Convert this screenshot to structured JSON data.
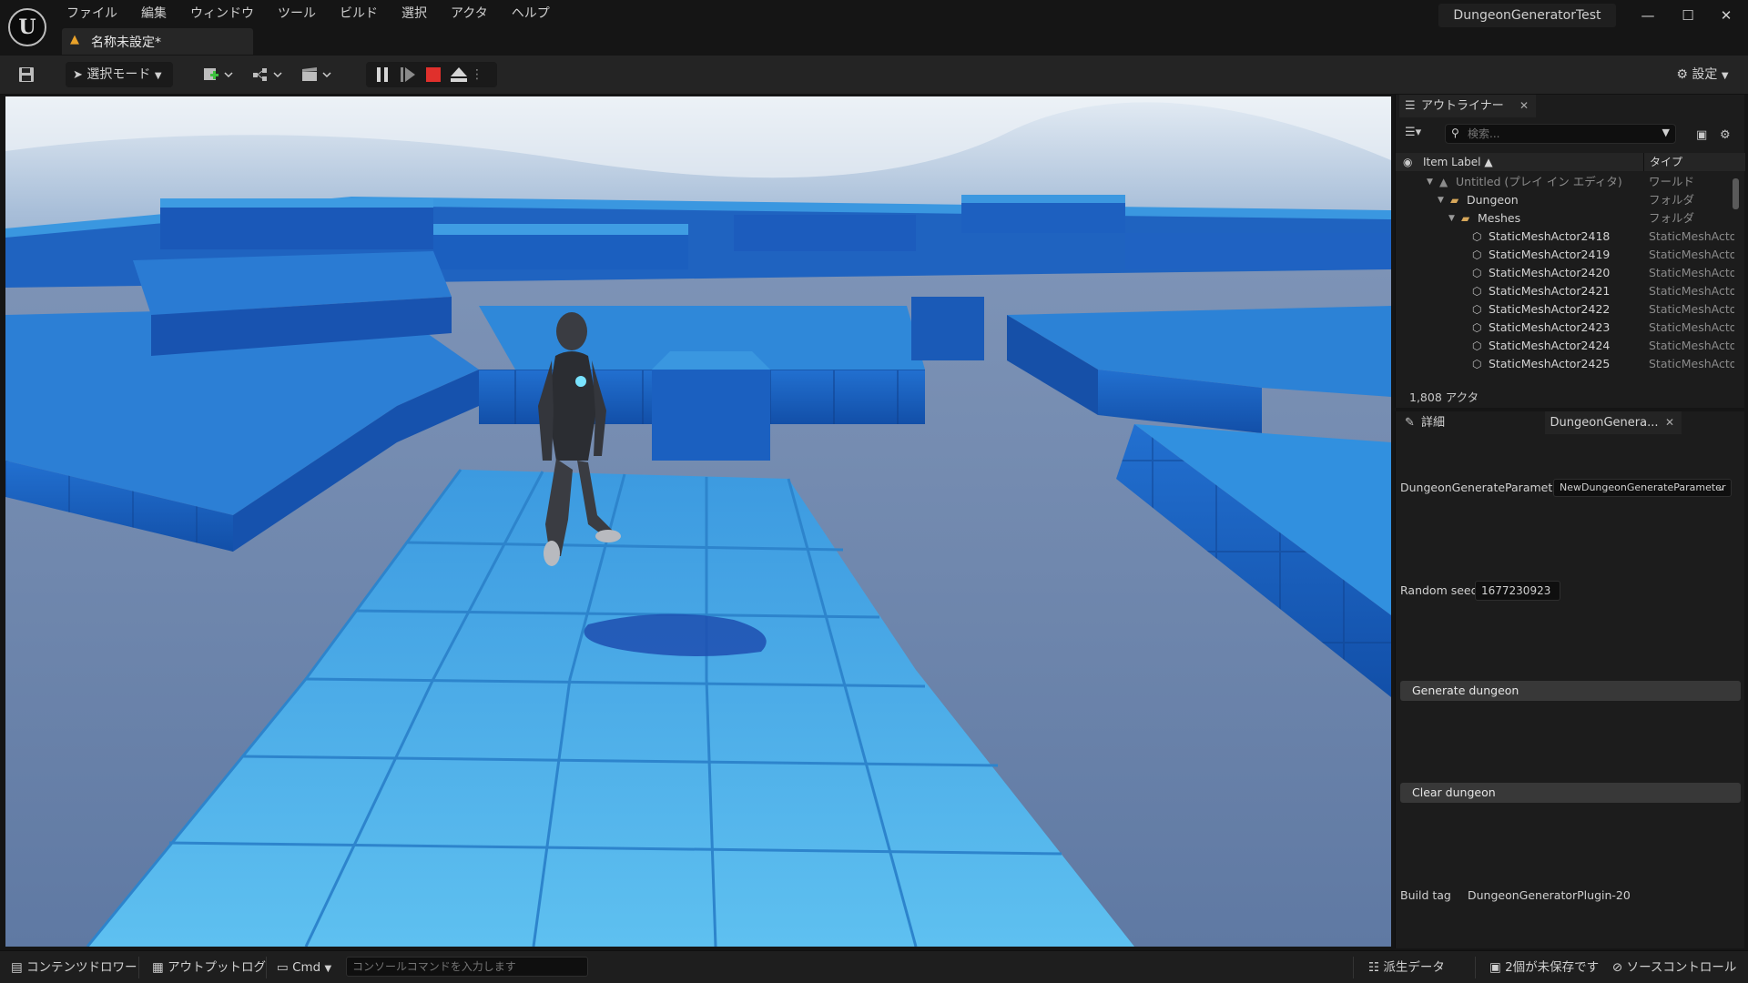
{
  "app": {
    "logo_letter": "U",
    "menu": [
      "ファイル",
      "編集",
      "ウィンドウ",
      "ツール",
      "ビルド",
      "選択",
      "アクタ",
      "ヘルプ"
    ],
    "level_tab": "名称未設定*",
    "project_name": "DungeonGeneratorTest",
    "window_controls": {
      "minimize": "—",
      "maximize": "☐",
      "close": "✕"
    }
  },
  "toolbar": {
    "mode_label": "選択モード",
    "settings_label": "設定"
  },
  "outliner": {
    "tab_label": "アウトライナー",
    "search_placeholder": "検索...",
    "col_label": "Item Label ▲",
    "col_type": "タイプ",
    "rows": [
      {
        "name": "Untitled (プレイ イン エディタ)",
        "type": "ワールド",
        "indent": 0
      },
      {
        "name": "Dungeon",
        "type": "フォルダ",
        "indent": 1
      },
      {
        "name": "Meshes",
        "type": "フォルダ",
        "indent": 2
      },
      {
        "name": "StaticMeshActor2418",
        "type": "StaticMeshActo",
        "indent": 3
      },
      {
        "name": "StaticMeshActor2419",
        "type": "StaticMeshActo",
        "indent": 3
      },
      {
        "name": "StaticMeshActor2420",
        "type": "StaticMeshActo",
        "indent": 3
      },
      {
        "name": "StaticMeshActor2421",
        "type": "StaticMeshActo",
        "indent": 3
      },
      {
        "name": "StaticMeshActor2422",
        "type": "StaticMeshActo",
        "indent": 3
      },
      {
        "name": "StaticMeshActor2423",
        "type": "StaticMeshActo",
        "indent": 3
      },
      {
        "name": "StaticMeshActor2424",
        "type": "StaticMeshActo",
        "indent": 3
      },
      {
        "name": "StaticMeshActor2425",
        "type": "StaticMeshActo",
        "indent": 3
      }
    ],
    "actor_count": "1,808 アクタ"
  },
  "details": {
    "tab_label": "詳細",
    "tab2_label": "DungeonGenera...",
    "param_label": "DungeonGenerateParameter",
    "param_value": "NewDungeonGenerateParameter",
    "seed_label": "Random seed",
    "seed_value": "1677230923",
    "generate_button": "Generate dungeon",
    "clear_button": "Clear dungeon",
    "build_tag_label": "Build tag",
    "build_tag_value": "DungeonGeneratorPlugin-20"
  },
  "statusbar": {
    "content_drawer": "コンテンツドロワー",
    "output_log": "アウトプットログ",
    "cmd_label": "Cmd",
    "cmd_placeholder": "コンソールコマンドを入力します",
    "derived_data": "派生データ",
    "unsaved": "2個が未保存です",
    "source_control": "ソースコントロール"
  },
  "colors": {
    "tile_top": "#4fb3e8",
    "tile_side": "#1a5fc0",
    "floor": "#6d84a8",
    "sky_top": "#c9d7e6",
    "accent_red": "#e0302c"
  },
  "icons": [
    "save-icon",
    "cursor-icon",
    "add-actor-icon",
    "blueprint-icon",
    "cinematics-icon",
    "pause-icon",
    "step-icon",
    "stop-icon",
    "eject-icon",
    "gear-icon",
    "outliner-icon",
    "filter-icon",
    "search-icon",
    "folder-icon",
    "mesh-icon",
    "eye-icon",
    "pencil-icon"
  ]
}
